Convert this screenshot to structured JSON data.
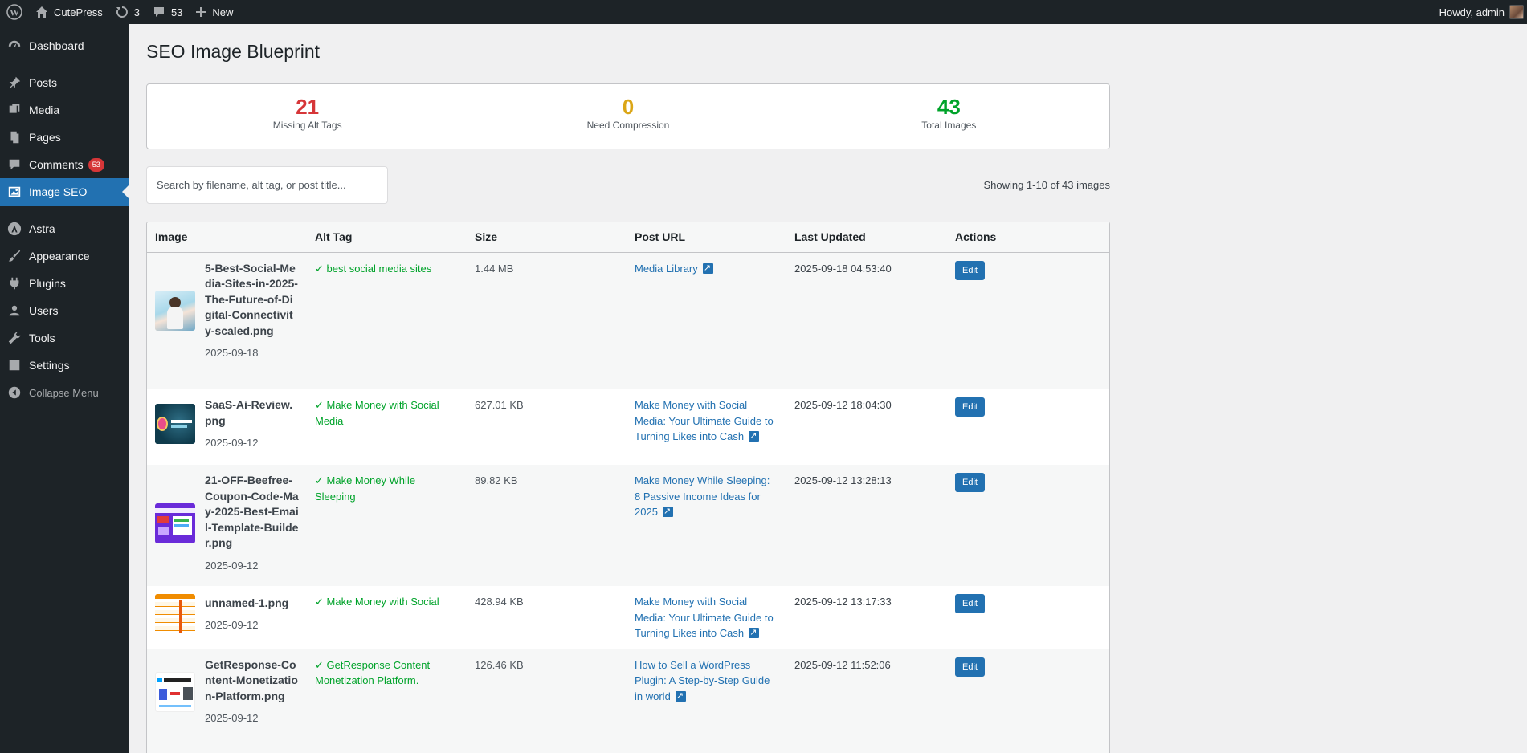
{
  "adminbar": {
    "site_name": "CutePress",
    "updates_count": "3",
    "comments_count": "53",
    "new_label": "New",
    "howdy": "Howdy, admin"
  },
  "sidebar": {
    "items": [
      {
        "label": "Dashboard",
        "icon": "dashboard-icon"
      },
      {
        "label": "Posts",
        "icon": "pin-icon"
      },
      {
        "label": "Media",
        "icon": "media-icon"
      },
      {
        "label": "Pages",
        "icon": "pages-icon"
      },
      {
        "label": "Comments",
        "icon": "comments-icon",
        "badge": "53"
      },
      {
        "label": "Image SEO",
        "icon": "image-icon",
        "current": true
      },
      {
        "label": "Astra",
        "icon": "astra-icon"
      },
      {
        "label": "Appearance",
        "icon": "brush-icon"
      },
      {
        "label": "Plugins",
        "icon": "plug-icon"
      },
      {
        "label": "Users",
        "icon": "user-icon"
      },
      {
        "label": "Tools",
        "icon": "wrench-icon"
      },
      {
        "label": "Settings",
        "icon": "settings-icon"
      },
      {
        "label": "Collapse Menu",
        "icon": "collapse-icon"
      }
    ]
  },
  "page": {
    "title": "SEO Image Blueprint"
  },
  "stats": [
    {
      "value": "21",
      "label": "Missing Alt Tags",
      "color": "#d63638"
    },
    {
      "value": "0",
      "label": "Need Compression",
      "color": "#dba617"
    },
    {
      "value": "43",
      "label": "Total Images",
      "color": "#00a32a"
    }
  ],
  "search": {
    "placeholder": "Search by filename, alt tag, or post title..."
  },
  "showing": "Showing 1-10 of 43 images",
  "table": {
    "headers": [
      "Image",
      "Alt Tag",
      "Size",
      "Post URL",
      "Last Updated",
      "Actions"
    ],
    "rows": [
      {
        "filename": "5-Best-Social-Media-Sites-in-2025-The-Future-of-Digital-Connectivity-scaled.png",
        "date": "2025-09-18",
        "alt": "✓ best social media sites",
        "size": "1.44 MB",
        "post": "Media Library",
        "updated": "2025-09-18 04:53:40",
        "action": "Edit"
      },
      {
        "filename": "SaaS-Ai-Review.png",
        "date": "2025-09-12",
        "alt": "✓ Make Money with Social Media",
        "size": "627.01 KB",
        "post": "Make Money with Social Media: Your Ultimate Guide to Turning Likes into Cash",
        "updated": "2025-09-12 18:04:30",
        "action": "Edit"
      },
      {
        "filename": "21-OFF-Beefree-Coupon-Code-May-2025-Best-Email-Template-Builder.png",
        "date": "2025-09-12",
        "alt": "✓ Make Money While Sleeping",
        "size": "89.82 KB",
        "post": "Make Money While Sleeping: 8 Passive Income Ideas for 2025",
        "updated": "2025-09-12 13:28:13",
        "action": "Edit"
      },
      {
        "filename": "unnamed-1.png",
        "date": "2025-09-12",
        "alt": "✓ Make Money with Social",
        "size": "428.94 KB",
        "post": "Make Money with Social Media: Your Ultimate Guide to Turning Likes into Cash",
        "updated": "2025-09-12 13:17:33",
        "action": "Edit"
      },
      {
        "filename": "GetResponse-Content-Monetization-Platform.png",
        "date": "2025-09-12",
        "alt": "✓ GetResponse Content Monetization Platform.",
        "size": "126.46 KB",
        "post": "How to Sell a WordPress Plugin: A Step-by-Step Guide in world",
        "updated": "2025-09-12 11:52:06",
        "action": "Edit"
      }
    ]
  }
}
